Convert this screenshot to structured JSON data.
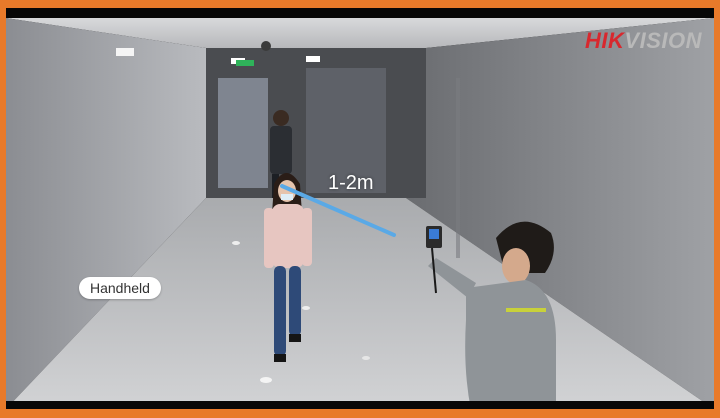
{
  "brand": {
    "logo_hik": "HIK",
    "logo_vision": "VISION",
    "logo_color": "#d8282e"
  },
  "overlay": {
    "distance_label": "1-2m",
    "distance_line_color": "#5aa9e6",
    "mode_label": "Handheld"
  },
  "scene": {
    "frame_color": "#e87a2a",
    "subjects": [
      "woman-walking",
      "man-walking-background",
      "operator-with-thermal-camera"
    ]
  }
}
